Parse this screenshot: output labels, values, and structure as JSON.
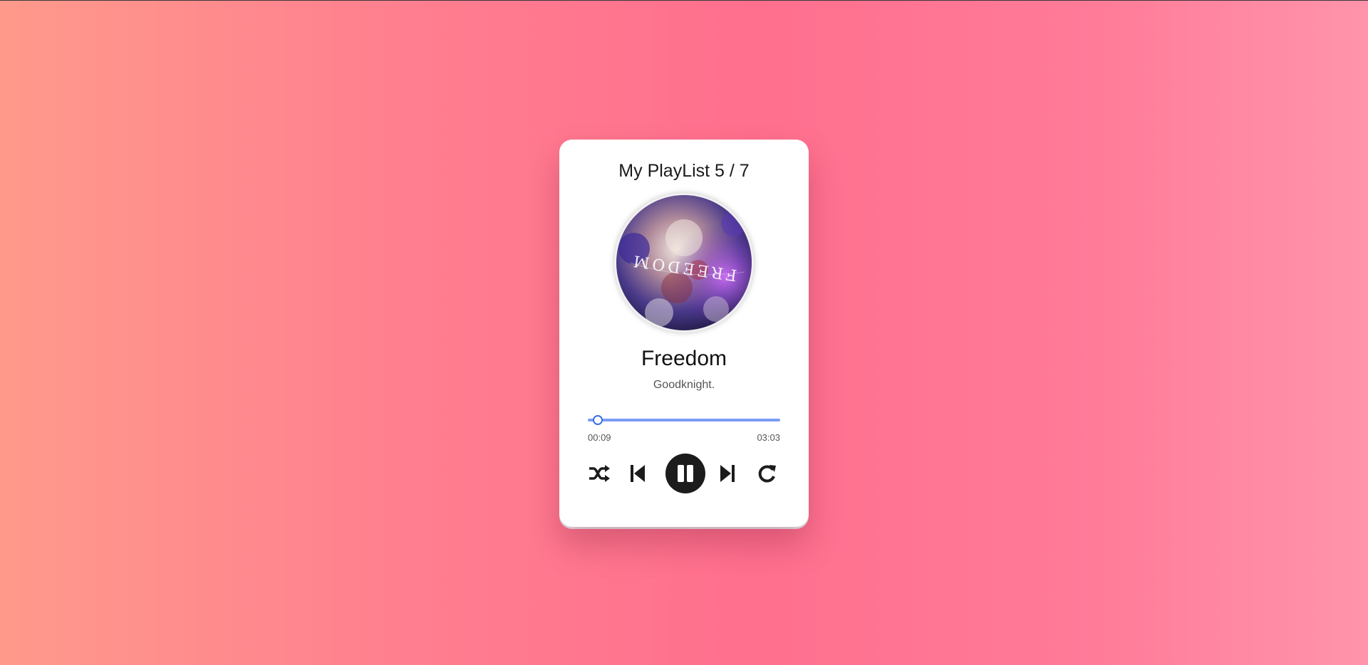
{
  "player": {
    "playlist_title": "My PlayList 5 / 7",
    "song_title": "Freedom",
    "artist": "Goodknight.",
    "cover_text": "FREEDOM",
    "time_elapsed": "00:09",
    "time_total": "03:03",
    "progress_fraction": 0.05,
    "is_playing": true
  },
  "controls": {
    "shuffle_icon": "shuffle-icon",
    "previous_icon": "skip-previous-icon",
    "play_pause_icon": "pause-icon",
    "next_icon": "skip-next-icon",
    "repeat_icon": "repeat-icon"
  },
  "colors": {
    "progress_track": "#7a9df5",
    "progress_thumb": "#3d6fe0",
    "play_button": "#1c1c1c"
  }
}
